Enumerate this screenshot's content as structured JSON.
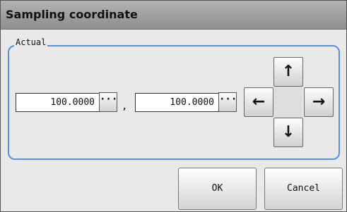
{
  "window": {
    "title": "Sampling coordinate"
  },
  "group": {
    "label": "Actual"
  },
  "coordinates": {
    "x_value": "100.0000",
    "y_value": "100.0000",
    "separator": ",",
    "edit_button_label": "···"
  },
  "arrows": {
    "up": "↑",
    "down": "↓",
    "left": "←",
    "right": "→"
  },
  "buttons": {
    "ok": "OK",
    "cancel": "Cancel"
  },
  "colors": {
    "group_border": "#5a8fe0",
    "titlebar": "#9f9f9f"
  }
}
